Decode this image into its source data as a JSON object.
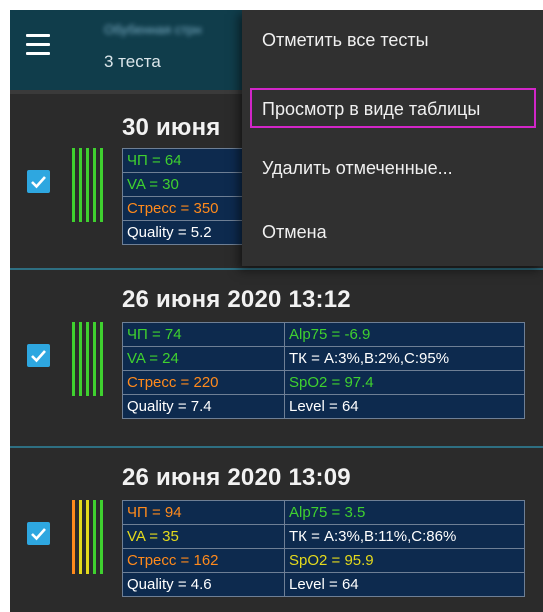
{
  "toolbar": {
    "title": "Обубенная стрн",
    "subtitle": "3 теста"
  },
  "menu": {
    "items": [
      "Отметить все тесты",
      "Просмотр в виде таблицы",
      "Удалить отмеченные...",
      "Отмена"
    ]
  },
  "colors": {
    "green": "#3fd12f",
    "yellow": "#e4da1c",
    "orange": "#ff8a1c",
    "checkbox": "#2ea7e0",
    "table_bg": "#0d2a4e",
    "toolbar_bg": "#103d4b",
    "highlight": "#d226c8"
  },
  "tests": [
    {
      "date": "30 июня",
      "checked": true,
      "bar_colors": [
        "green",
        "green",
        "green",
        "green",
        "green"
      ],
      "rows": [
        [
          "ЧП = 64",
          ""
        ],
        [
          "VA = 30",
          ""
        ],
        [
          "Стресс = 350",
          ""
        ],
        [
          "Quality = 5.2",
          ""
        ]
      ]
    },
    {
      "date": "26 июня 2020  13:12",
      "checked": true,
      "bar_colors": [
        "green",
        "green",
        "green",
        "green",
        "green"
      ],
      "rows": [
        [
          "ЧП = 74",
          "Alp75 = -6.9"
        ],
        [
          "VA = 24",
          "ТК = A:3%,B:2%,C:95%"
        ],
        [
          "Стресс = 220",
          "SpO2 = 97.4"
        ],
        [
          "Quality = 7.4",
          "Level = 64"
        ]
      ]
    },
    {
      "date": "26 июня 2020  13:09",
      "checked": true,
      "bar_colors": [
        "orange",
        "yellow",
        "yellow",
        "green",
        "green"
      ],
      "rows": [
        [
          "ЧП = 94",
          "Alp75 = 3.5"
        ],
        [
          "VA = 35",
          "ТК = A:3%,B:11%,C:86%"
        ],
        [
          "Стресс = 162",
          "SpO2 = 95.9"
        ],
        [
          "Quality = 4.6",
          "Level = 64"
        ]
      ]
    }
  ]
}
